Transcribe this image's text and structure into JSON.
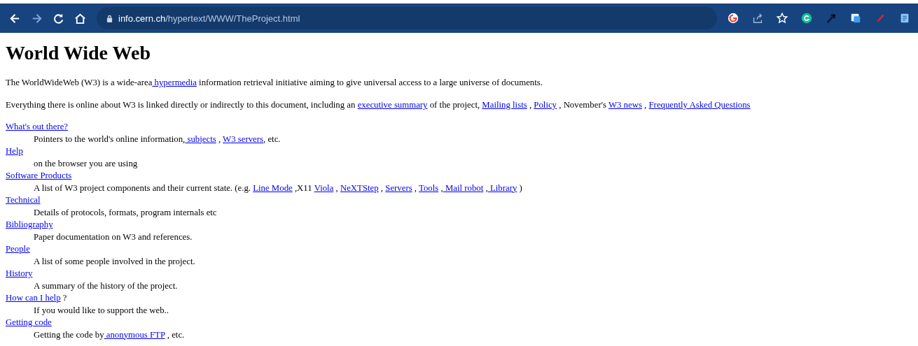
{
  "browser": {
    "nav": [
      {
        "kind": "back",
        "disabled": false
      },
      {
        "kind": "forward",
        "disabled": true
      },
      {
        "kind": "reload",
        "disabled": false
      },
      {
        "kind": "home",
        "disabled": false
      }
    ],
    "url": {
      "host": "info.cern.ch",
      "path": "/hypertext/WWW/TheProject.html"
    },
    "toolbar": [
      {
        "kind": "google"
      },
      {
        "kind": "share"
      },
      {
        "kind": "star"
      },
      {
        "kind": "grammar"
      },
      {
        "kind": "dropper"
      },
      {
        "kind": "translate"
      },
      {
        "kind": "marker"
      },
      {
        "kind": "page"
      }
    ]
  },
  "page": {
    "title": "World Wide Web",
    "paragraphs": [
      [
        {
          "text": "The WorldWideWeb (W3) is a wide-area",
          "kind": "text"
        },
        {
          "text": " hypermedia",
          "kind": "link"
        },
        {
          "text": " information retrieval initiative aiming to give universal access to a large universe of documents.",
          "kind": "text"
        }
      ],
      [
        {
          "text": "Everything there is online about W3 is linked directly or indirectly to this document, including an ",
          "kind": "text"
        },
        {
          "text": "executive summary",
          "kind": "link"
        },
        {
          "text": " of the project, ",
          "kind": "text"
        },
        {
          "text": "Mailing lists",
          "kind": "link"
        },
        {
          "text": " , ",
          "kind": "text"
        },
        {
          "text": "Policy",
          "kind": "link"
        },
        {
          "text": " , November's ",
          "kind": "text"
        },
        {
          "text": "W3 news",
          "kind": "link"
        },
        {
          "text": " , ",
          "kind": "text"
        },
        {
          "text": "Frequently Asked Questions",
          "kind": "link"
        }
      ]
    ],
    "entries": [
      {
        "term": [
          {
            "text": "What's out there?",
            "kind": "link"
          }
        ],
        "description": [
          {
            "text": "Pointers to the world's online information,",
            "kind": "text"
          },
          {
            "text": " subjects",
            "kind": "link"
          },
          {
            "text": " , ",
            "kind": "text"
          },
          {
            "text": "W3 servers",
            "kind": "link"
          },
          {
            "text": ", etc.",
            "kind": "text"
          }
        ]
      },
      {
        "term": [
          {
            "text": "Help",
            "kind": "link"
          }
        ],
        "description": [
          {
            "text": "on the browser you are using",
            "kind": "text"
          }
        ]
      },
      {
        "term": [
          {
            "text": "Software Products",
            "kind": "link"
          }
        ],
        "description": [
          {
            "text": "A list of W3 project components and their current state. (e.g. ",
            "kind": "text"
          },
          {
            "text": "Line Mode",
            "kind": "link"
          },
          {
            "text": " ,X11 ",
            "kind": "text"
          },
          {
            "text": "Viola",
            "kind": "link"
          },
          {
            "text": " , ",
            "kind": "text"
          },
          {
            "text": "NeXTStep",
            "kind": "link"
          },
          {
            "text": " , ",
            "kind": "text"
          },
          {
            "text": "Servers",
            "kind": "link"
          },
          {
            "text": " , ",
            "kind": "text"
          },
          {
            "text": "Tools",
            "kind": "link"
          },
          {
            "text": " ,",
            "kind": "text"
          },
          {
            "text": " Mail robot",
            "kind": "link"
          },
          {
            "text": " ,",
            "kind": "text"
          },
          {
            "text": " Library",
            "kind": "link"
          },
          {
            "text": " )",
            "kind": "text"
          }
        ]
      },
      {
        "term": [
          {
            "text": "Technical",
            "kind": "link"
          }
        ],
        "description": [
          {
            "text": "Details of protocols, formats, program internals etc",
            "kind": "text"
          }
        ]
      },
      {
        "term": [
          {
            "text": "Bibliography",
            "kind": "link"
          }
        ],
        "description": [
          {
            "text": "Paper documentation on W3 and references.",
            "kind": "text"
          }
        ]
      },
      {
        "term": [
          {
            "text": "People",
            "kind": "link"
          }
        ],
        "description": [
          {
            "text": "A list of some people involved in the project.",
            "kind": "text"
          }
        ]
      },
      {
        "term": [
          {
            "text": "History",
            "kind": "link"
          }
        ],
        "description": [
          {
            "text": "A summary of the history of the project.",
            "kind": "text"
          }
        ]
      },
      {
        "term": [
          {
            "text": "How can I help",
            "kind": "link"
          },
          {
            "text": " ?",
            "kind": "text"
          }
        ],
        "description": [
          {
            "text": "If you would like to support the web..",
            "kind": "text"
          }
        ]
      },
      {
        "term": [
          {
            "text": "Getting code",
            "kind": "link"
          }
        ],
        "description": [
          {
            "text": "Getting the code by",
            "kind": "text"
          },
          {
            "text": " anonymous FTP",
            "kind": "link"
          },
          {
            "text": " , etc.",
            "kind": "text"
          }
        ]
      }
    ]
  }
}
